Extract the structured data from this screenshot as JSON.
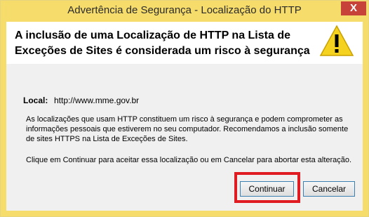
{
  "window": {
    "title": "Advertência de Segurança - Localização do HTTP",
    "close_label": "X"
  },
  "header": {
    "message": "A inclusão de uma Localização de HTTP na Lista de Exceções de Sites é considerada um risco à segurança",
    "icon": "warning-icon"
  },
  "details": {
    "local_label": "Local:",
    "local_url": "http://www.mme.gov.br",
    "warning_text": "As localizações que usam HTTP constituem um risco à segurança e podem comprometer as informações pessoais que estiverem no seu computador. Recomendamos a inclusão somente de sites HTTPS na Lista de Exceções de Sites.",
    "instruction_text": "Clique em Continuar para aceitar essa localização ou em Cancelar para abortar esta alteração."
  },
  "buttons": {
    "continue_label": "Continuar",
    "cancel_label": "Cancelar"
  },
  "colors": {
    "titlebar": "#f6dc6b",
    "close_button": "#c7433a",
    "highlight": "#e01b22"
  }
}
